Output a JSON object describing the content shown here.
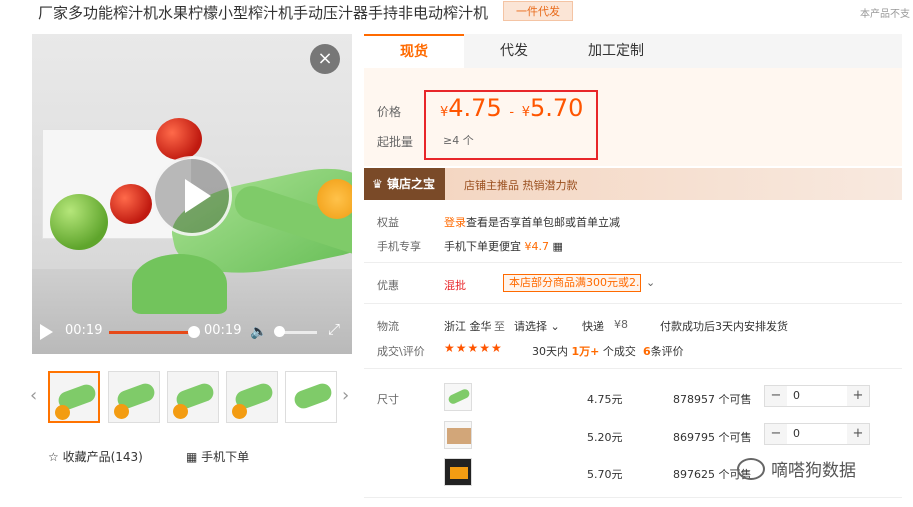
{
  "product": {
    "title": "厂家多功能榨汁机水果柠檬小型榨汁机手动压汁器手持非电动榨汁机",
    "badge": "一件代发",
    "notice": "本产品不支"
  },
  "video": {
    "current_time": "00:19",
    "duration": "00:19",
    "progress": 1.0,
    "close_icon": "×"
  },
  "thumbnails": {
    "count": 5,
    "selected_index": 0
  },
  "actions": {
    "favorite": "收藏产品(143)",
    "mobile_order": "手机下单"
  },
  "tabs": [
    {
      "label": "现货",
      "active": true
    },
    {
      "label": "代发",
      "active": false
    },
    {
      "label": "加工定制",
      "active": false
    }
  ],
  "pricing": {
    "price_label": "价格",
    "price_low": "4.75",
    "price_high": "5.70",
    "currency": "¥",
    "separator": "-",
    "moq_label": "起批量",
    "moq_value": "≥4 个"
  },
  "shop": {
    "tag": "镇店之宝",
    "desc": "店铺主推品  热销潜力款"
  },
  "benefits": {
    "label": "权益",
    "login": "登录",
    "text": "查看是否享首单包邮或首单立减"
  },
  "mobile_exclusive": {
    "label": "手机专享",
    "text": "手机下单更便宜",
    "price": "¥4.7"
  },
  "discount": {
    "label": "优惠",
    "type": "混批",
    "promo": "本店部分商品满300元或2..."
  },
  "logistics": {
    "label": "物流",
    "origin": "浙江 金华",
    "to": "至",
    "dest": "请选择",
    "express": "快递",
    "fee": "¥8",
    "ship_note": "付款成功后3天内安排发货"
  },
  "reviews": {
    "label": "成交\\评价",
    "stars": "★★★★★",
    "days": "30天内",
    "volume": "1万+",
    "volume_suffix": "个成交",
    "review_count": "6",
    "review_suffix": "条评价"
  },
  "sku": {
    "label": "尺寸",
    "items": [
      {
        "price": "4.75元",
        "stock": "878957 个可售",
        "qty": "0"
      },
      {
        "price": "5.20元",
        "stock": "869795 个可售",
        "qty": "0"
      },
      {
        "price": "5.70元",
        "stock": "897625 个可售",
        "qty": ""
      }
    ]
  },
  "watermark": "嘀嗒狗数据",
  "colors": {
    "accent": "#ff6a00",
    "price": "#ff5500",
    "frame": "#e8262a"
  }
}
